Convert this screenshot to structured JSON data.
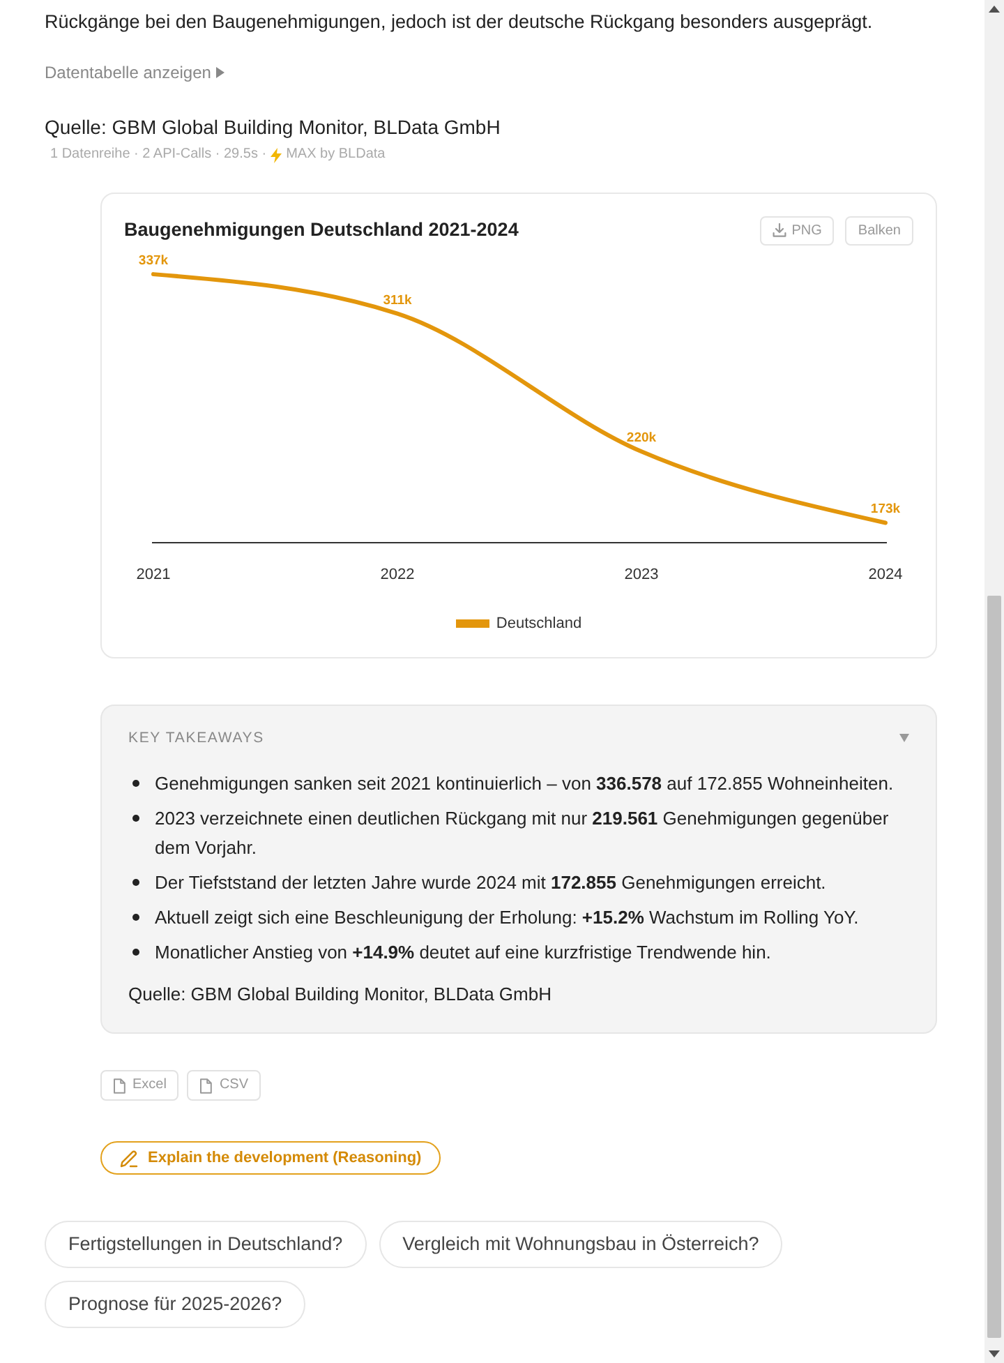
{
  "summary": {
    "text": "Rückgänge bei den Baugenehmigungen, jedoch ist der deutsche Rückgang besonders ausgeprägt."
  },
  "data_table_toggle": {
    "label": "Datentabelle anzeigen",
    "expanded": false
  },
  "source": "Quelle: GBM Global Building Monitor, BLData GmbH",
  "meta": {
    "text": "1 Datenreihe · 2 API-Calls · 29.5s ·",
    "model": "MAX by BLData"
  },
  "chart_card": {
    "actions": [
      {
        "label": "PNG",
        "kind": "download"
      },
      {
        "label": "Balken",
        "kind": "toggle"
      }
    ],
    "chart_data": {
      "type": "line",
      "title": "Baugenehmigungen Deutschland 2021-2024",
      "categories": [
        "2021",
        "2022",
        "2023",
        "2024"
      ],
      "series": [
        {
          "name": "Deutschland",
          "color": "#e3960c",
          "values": [
            337000,
            311000,
            220000,
            173000
          ],
          "value_labels": [
            "337k",
            "311k",
            "220k",
            "173k"
          ]
        }
      ]
    }
  },
  "takeaways": {
    "title": "KEY TAKEAWAYS",
    "expanded": true,
    "items": [
      "Genehmigungen sanken seit 2021 kontinuierlich – von **336.578** auf 172.855 Wohneinheiten.",
      "2023 verzeichnete einen deutlichen Rückgang mit nur **219.561** Genehmigungen gegenüber dem Vorjahr.",
      "Der Tiefststand der letzten Jahre wurde 2024 mit **172.855** Genehmigungen erreicht.",
      "Aktuell zeigt sich eine Beschleunigung der Erholung: **+15.2%** Wachstum im Rolling YoY.",
      "Monatlicher Anstieg von **+14.9%** deutet auf eine kurzfristige Trendwende hin."
    ],
    "source": "Quelle: GBM Global Building Monitor, BLData GmbH"
  },
  "exports": [
    {
      "label": "Excel"
    },
    {
      "label": "CSV"
    }
  ],
  "reasoning_button": {
    "label": "Explain the development (Reasoning)"
  },
  "suggestions": [
    "Fertigstellungen in Deutschland?",
    "Vergleich mit Wohnungsbau in Österreich?",
    "Prognose für 2025-2026?"
  ]
}
